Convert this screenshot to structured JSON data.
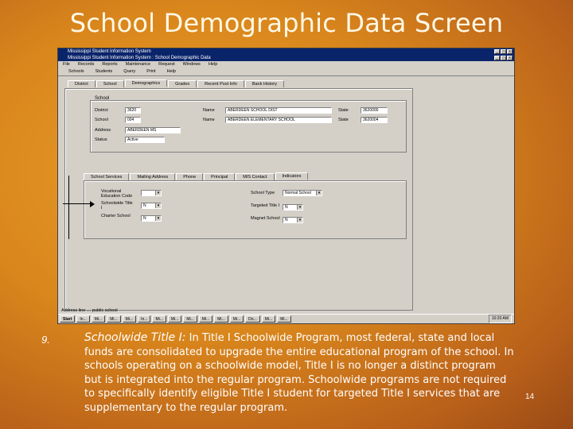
{
  "slide": {
    "title": "School Demographic Data Screen",
    "item_number": "9.",
    "item_heading": "Schoolwide Title I:",
    "item_text": " In Title I Schoolwide Program, most federal, state and local funds are consolidated to upgrade the entire educational program of the school.  In schools operating on a schoolwide model, Title I is no longer a distinct program but is integrated into the regular program.  Schoolwide programs are not required to specifically identify eligible Title I student for targeted Title I services that are supplementary to the regular program.",
    "page_number": "14"
  },
  "window": {
    "outer_title": "Mississippi Student Information System",
    "inner_title": "Mississippi Student Information System : School Demographic Data",
    "controls": [
      "_",
      "□",
      "x"
    ],
    "menu": [
      "File",
      "Records",
      "Reports",
      "Maintenance",
      "Request",
      "Windows",
      "Help"
    ],
    "toolbar": [
      "Schools",
      "Students",
      "Query",
      "Print",
      "Help"
    ],
    "top_tabs": [
      "District",
      "School",
      "Demographics",
      "Grades",
      "Recent Post Info",
      "Bank History"
    ],
    "school_group_label": "School",
    "fields": {
      "district_label": "District",
      "district_value": "3620",
      "name_label": "Name",
      "district_name": "ABERDEEN SCHOOL DIST",
      "code_label": "State",
      "district_code": "3620000",
      "school_label": "School",
      "school_value": "004",
      "school_name_label": "Name",
      "school_name": "ABERDEEN ELEMENTARY SCHOOL",
      "school_code_label": "State",
      "school_code": "3620004",
      "address_label": "Address",
      "address_value": "ABERDEEN MS",
      "status_label": "Status",
      "status_value": "Active"
    },
    "bottom_tabs": [
      "School Services",
      "Mailing Address",
      "Phone",
      "Principal",
      "MIS Contact",
      "Indicators"
    ],
    "indicators": {
      "schoolwide_code_label": "Vocational Education Code",
      "schoolwide_label": "Schoolwide Title I",
      "schoolwide_value": "N",
      "charter_label": "Charter School",
      "charter_value": "N",
      "school_type_label": "School Type",
      "school_type_value": "Normal School",
      "targeted_label": "Targeted Title I",
      "targeted_value": "N",
      "magnet_label": "Magnet School",
      "magnet_value": "N"
    },
    "status_text": "Address line … public school",
    "taskbar": [
      "Start",
      "In...",
      "Mi...",
      "Mi...",
      "Mi...",
      "In...",
      "Mi...",
      "Mi...",
      "Mi...",
      "Mi...",
      "Mi...",
      "Mi...",
      "Do...",
      "Mi...",
      "Mi..."
    ],
    "clock": "10:20 AM"
  }
}
